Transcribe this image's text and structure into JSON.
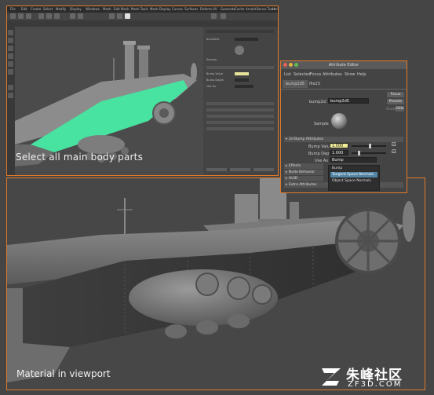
{
  "top_screenshot": {
    "caption": "Select all main body parts",
    "menu_items": [
      "File",
      "Edit",
      "Create",
      "Select",
      "Modify",
      "Display",
      "Windows",
      "Mesh",
      "Edit Mesh",
      "Mesh Tools",
      "Mesh Display",
      "Curves",
      "Surfaces",
      "Deform",
      "UV",
      "Generate",
      "Cache",
      "Arnold",
      "Bonus Tools",
      "Help"
    ],
    "attr_panel_rows": [
      "bump2d1",
      "Sample",
      "Bump Value",
      "Bump Depth",
      "Use As",
      "Effects",
      "Node Behavior",
      "UUID",
      "Extra Attributes"
    ]
  },
  "attribute_editor": {
    "title": "Attribute Editor",
    "menu": [
      "List",
      "Selected",
      "Focus",
      "Attributes",
      "Show",
      "Help"
    ],
    "tabs": [
      "bump2d5",
      "file23"
    ],
    "bump2d_label": "bump2d:",
    "bump2d_value": "bump2d5",
    "buttons": {
      "focus": "Focus",
      "presets": "Presets",
      "show": "Show",
      "hide": "Hide"
    },
    "sample_label": "Sample",
    "sections": {
      "bump_attributes": "2d Bump Attributes",
      "effects": "Effects",
      "node_behavior": "Node Behavior",
      "uuid": "UUID",
      "extra_attributes": "Extra Attributes"
    },
    "bump_value_label": "Bump Value",
    "bump_value": "1.000",
    "bump_depth_label": "Bump Depth",
    "bump_depth": "1.000",
    "use_as_label": "Use As",
    "use_as_value": "Bump",
    "use_as_options": [
      "Bump",
      "Tangent Space Normals",
      "Object Space Normals"
    ],
    "use_as_selected": "Tangent Space Normals"
  },
  "bottom_viewport": {
    "caption": "Material in viewport"
  },
  "watermark": {
    "cn": "朱峰社区",
    "en": "ZF3D.COM"
  },
  "colors": {
    "frame_accent": "#e07a2a",
    "selection_green": "#48e3a0",
    "dropdown_highlight": "#5285a6"
  }
}
